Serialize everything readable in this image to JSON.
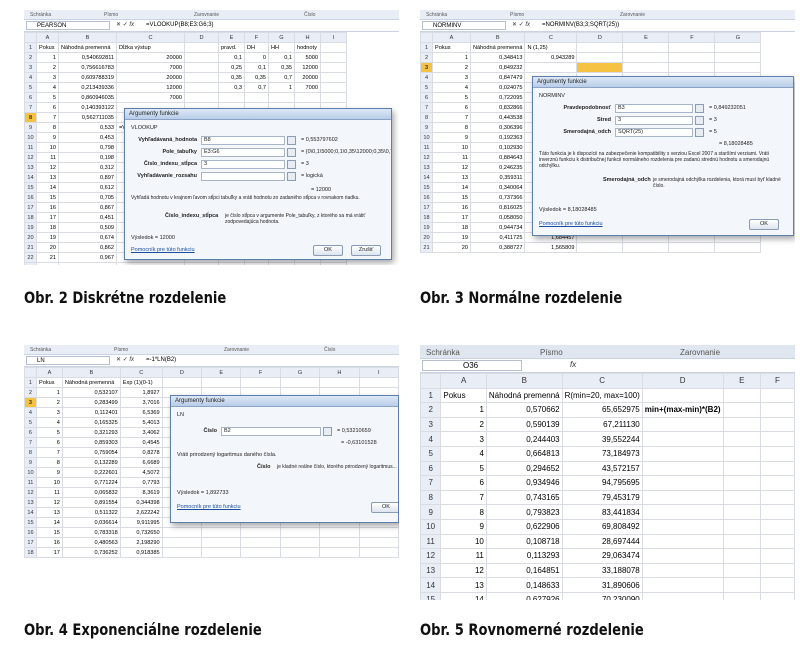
{
  "captions": [
    "Obr. 2 Diskrétne rozdelenie",
    "Obr. 3 Normálne rozdelenie",
    "Obr. 4 Exponenciálne rozdelenie",
    "Obr. 5 Rovnomerné rozdelenie"
  ],
  "p1": {
    "ribbon": [
      "Schránka",
      "Písmo",
      "Zarovnanie",
      "Číslo"
    ],
    "namebox": "PEARSON",
    "formula": "=VLOOKUP(B8;E3:G6;3)",
    "cols": [
      "",
      "A",
      "B",
      "C",
      "D",
      "E",
      "F",
      "G",
      "H",
      "I"
    ],
    "header": [
      "Pokus",
      "Náhodná premenná",
      "Dĺžka výstup",
      "",
      "pravd.",
      "DH",
      "HH",
      "hodnoty"
    ],
    "a": [
      "1",
      "2",
      "3",
      "4",
      "5",
      "6",
      "7",
      "8",
      "9",
      "10",
      "11",
      "12",
      "13",
      "14",
      "15",
      "16",
      "17",
      "18",
      "19",
      "20",
      "21",
      "22",
      "23",
      "24"
    ],
    "b": [
      "0,540692811",
      "0,756616783",
      "0,609788319",
      "0,213439336",
      "0,860946035",
      "0,140393122",
      "0,562711035",
      "0,533",
      "0,453",
      "0,798",
      "0,198",
      "0,312",
      "0,897",
      "0,612",
      "0,705",
      "0,867",
      "0,451",
      "0,509",
      "0,674",
      "0,862",
      "0,967",
      "0,312",
      "0,767",
      "0,940818917"
    ],
    "c": [
      "20000",
      "7000",
      "20000",
      "12000",
      "7000",
      "",
      "",
      "=VLOOKUP(B8;E3:G6;3)",
      "",
      "",
      "",
      "",
      "",
      "",
      "",
      "",
      "",
      "",
      "",
      "",
      "",
      "",
      "7000",
      "5000"
    ],
    "tbl": [
      [
        "0,1",
        "0",
        "0,1",
        "5000"
      ],
      [
        "0,25",
        "0,1",
        "0,35",
        "12000"
      ],
      [
        "0,35",
        "0,35",
        "0,7",
        "20000"
      ],
      [
        "0,3",
        "0,7",
        "1",
        "7000"
      ]
    ],
    "dlg": {
      "title": "Argumenty funkcie",
      "fn": "VLOOKUP",
      "args": [
        [
          "Vyhľadávaná_hodnota",
          "B8",
          "= 0,553797602"
        ],
        [
          "Pole_tabuľky",
          "E3:G6",
          "= {0\\0,1\\5000;0,1\\0,35\\12000;0,35\\0,7\\...}"
        ],
        [
          "Číslo_indexu_stĺpca",
          "3",
          "= 3"
        ],
        [
          "Vyhľadávanie_rozsahu",
          "",
          "= logická"
        ]
      ],
      "res": "= 12000",
      "desc": "Vyhľadá hodnotu v krajnom ľavom stĺpci tabuľky a vráti hodnotu zo zadaného stĺpca v rovnakom riadku.",
      "argname": "Číslo_indexu_stĺpca",
      "argdesc": "je číslo stĺpca v argumente Pole_tabuľky, z ktorého sa má vrátiť zodpovedajúca hodnota.",
      "result": "Výsledok = 12000",
      "help": "Pomocník pre túto funkciu",
      "ok": "OK",
      "cancel": "Zrušiť"
    }
  },
  "p2": {
    "ribbon": [
      "Schránka",
      "Písmo",
      "Zarovnanie"
    ],
    "namebox": "NORMINV",
    "formula": "=NORMINV(B3;3;SQRT(25))",
    "cols": [
      "",
      "A",
      "B",
      "C",
      "D",
      "E",
      "F",
      "G"
    ],
    "header": [
      "Pokus",
      "Náhodná premenná",
      "N (1,25)"
    ],
    "a": [
      "1",
      "2",
      "3",
      "4",
      "5",
      "6",
      "7",
      "8",
      "9",
      "10",
      "11",
      "12",
      "13",
      "14",
      "15",
      "16",
      "17",
      "18",
      "19",
      "20"
    ],
    "b": [
      "0,348413",
      "0,849232",
      "0,847479",
      "0,024075",
      "0,722095",
      "0,832866",
      "0,443538",
      "0,306396",
      "0,192363",
      "0,102930",
      "0,884643",
      "0,246235",
      "0,359311",
      "0,340064",
      "0,737366",
      "0,816025",
      "0,058050",
      "0,944734",
      "0,411725",
      "0,388727"
    ],
    "c": [
      "0,943289",
      "",
      "",
      "",
      "",
      "",
      "",
      "",
      "",
      "",
      "",
      "",
      "",
      "",
      "",
      "",
      "",
      "12,548859",
      "1,684457",
      "1,565809"
    ],
    "dlg": {
      "title": "Argumenty funkcie",
      "fn": "NORMINV",
      "args": [
        [
          "Pravdepodobnosť",
          "B3",
          "= 0,849232051"
        ],
        [
          "Stred",
          "3",
          "= 3"
        ],
        [
          "Smerodajná_odch",
          "SQRT(25)",
          "= 5"
        ]
      ],
      "res": "= 8,18028485",
      "desc": "Táto funkcia je k dispozícii na zabezpečenie kompatibility s verziou Excel 2007 a staršími verziami. Vráti inverznú funkciu k distribučnej funkcii normálneho rozdelenia pre zadanú strednú hodnotu a smerodajnú odchýlku.",
      "argname": "Smerodajná_odch",
      "argdesc": "je smerodajná odchýlka rozdelenia, ktorá musí byť kladné číslo.",
      "result": "Výsledok = 8,18028485",
      "help": "Pomocník pre túto funkciu",
      "ok": "OK"
    }
  },
  "p3": {
    "ribbon": [
      "Schránka",
      "Písmo",
      "Zarovnanie",
      "Číslo"
    ],
    "namebox": "LN",
    "formula": "=-1*LN(B2)",
    "cols": [
      "",
      "A",
      "B",
      "C",
      "D",
      "E",
      "F",
      "G",
      "H",
      "I"
    ],
    "header": [
      "Pokus",
      "Náhodná premenná",
      "Exp (1)(0-1)"
    ],
    "a": [
      "1",
      "2",
      "3",
      "4",
      "5",
      "6",
      "7",
      "8",
      "9",
      "10",
      "11",
      "12",
      "13",
      "14",
      "15",
      "16"
    ],
    "b": [
      "0,532107",
      "0,283499",
      "0,112401",
      "0,165325",
      "0,321293",
      "0,859303",
      "0,759054",
      "0,132289",
      "0,222601",
      "0,771224",
      "0,065832",
      "0,891554",
      "0,511322",
      "0,036614",
      "0,783318",
      "0,480563"
    ],
    "c": [
      "1,8927",
      "3,7016",
      "6,5369",
      "5,4013",
      "3,4062",
      "0,4545",
      "0,8278",
      "6,6689",
      "4,5072",
      "0,7793",
      "8,3619",
      "0,344398",
      "2,622242",
      "9,911995",
      "0,732650",
      "2,198290"
    ],
    "extra": [
      "17",
      "0,736252",
      "0,918385"
    ],
    "dlg": {
      "title": "Argumenty funkcie",
      "fn": "LN",
      "args": [
        [
          "Číslo",
          "B2",
          "= 0,53210659"
        ]
      ],
      "res": "= -0,63101528",
      "desc": "Vráti prirodzený logaritmus daného čísla.",
      "argname": "Číslo",
      "argdesc": "je kladné reálne číslo, ktorého prirodzený logaritmus...",
      "result": "Výsledok = 1,892733",
      "help": "Pomocník pre túto funkciu",
      "ok": "OK"
    }
  },
  "p4": {
    "ribbon": [
      "Schránka",
      "Písmo",
      "Zarovnanie"
    ],
    "namebox": "O36",
    "fx": "fx",
    "cols": [
      "",
      "A",
      "B",
      "C",
      "D",
      "E",
      "F"
    ],
    "header": [
      "Pokus",
      "Náhodná premenná",
      "R(min=20, max=100)"
    ],
    "note": "min+(max-min)*(B2)",
    "a": [
      "1",
      "2",
      "3",
      "4",
      "5",
      "6",
      "7",
      "8",
      "9",
      "10",
      "11",
      "12",
      "13",
      "14"
    ],
    "b": [
      "0,570662",
      "0,590139",
      "0,244403",
      "0,664813",
      "0,294652",
      "0,934946",
      "0,743165",
      "0,793823",
      "0,622906",
      "0,108718",
      "0,113293",
      "0,164851",
      "0,148633",
      "0,627926"
    ],
    "c": [
      "65,652975",
      "67,211130",
      "39,552244",
      "73,184973",
      "43,572157",
      "94,795695",
      "79,453179",
      "83,441834",
      "69,808492",
      "28,697444",
      "29,063474",
      "33,188078",
      "31,890606",
      "70,230090"
    ]
  }
}
